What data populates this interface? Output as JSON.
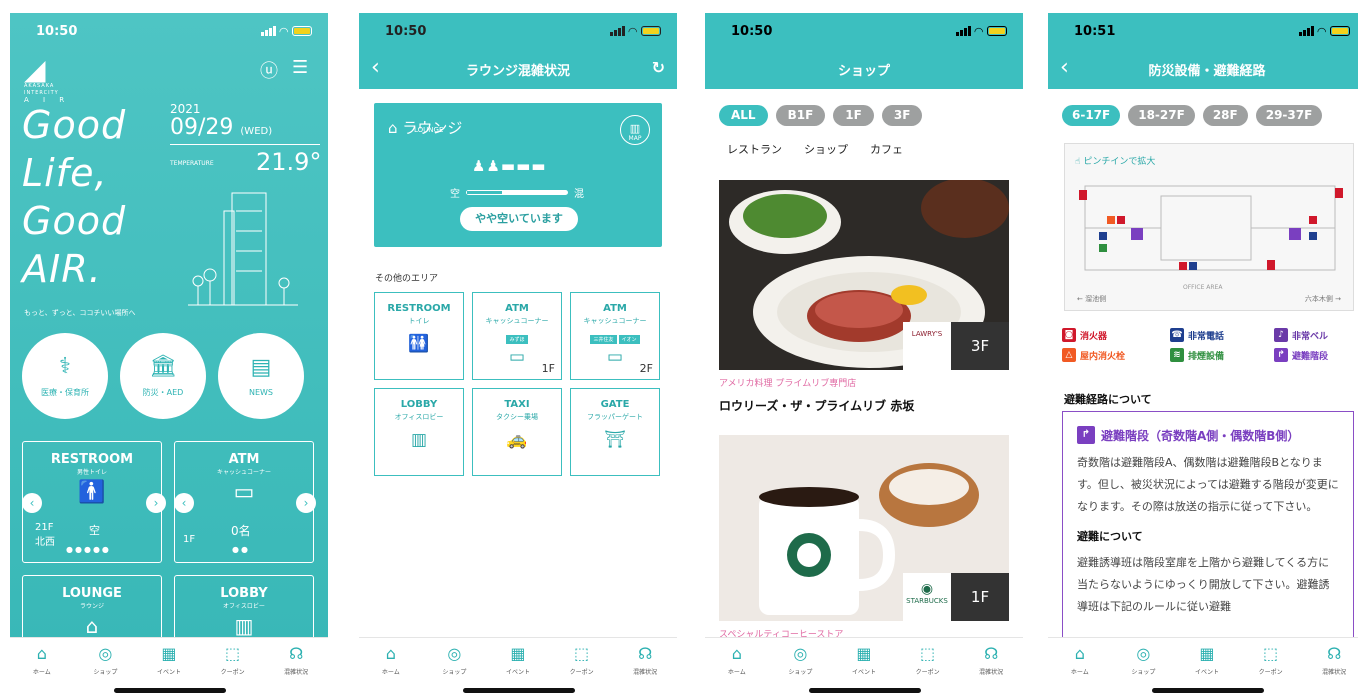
{
  "status_time": [
    "10:50",
    "10:50",
    "10:50",
    "10:51"
  ],
  "tabs": [
    {
      "label": "ホーム",
      "icon": "house-icon"
    },
    {
      "label": "ショップ",
      "icon": "plate-icon"
    },
    {
      "label": "イベント",
      "icon": "calendar-icon"
    },
    {
      "label": "クーポン",
      "icon": "coupon-icon"
    },
    {
      "label": "混雑状況",
      "icon": "crowd-icon"
    }
  ],
  "home": {
    "logo": [
      "AKASAKA",
      "INTERCITY",
      "A I R"
    ],
    "slogan": [
      "Good",
      "Life,",
      "Good",
      "AIR."
    ],
    "tagline": "もっと、ずっと、ココチいい場所へ",
    "year": "2021",
    "date": "09/29",
    "weekday": "(WED)",
    "temp_label": "TEMPERATURE",
    "temp_value": "21.9°",
    "circles": [
      {
        "label": "医療・保育所",
        "icon": "stethoscope-icon"
      },
      {
        "label": "防災・AED",
        "icon": "building-icon"
      },
      {
        "label": "NEWS",
        "icon": "news-icon"
      }
    ],
    "cards": [
      {
        "title": "RESTROOM",
        "sub": "男性トイレ",
        "floor": "21F",
        "area": "北西",
        "state": "空"
      },
      {
        "title": "ATM",
        "sub": "キャッシュコーナー",
        "floor": "1F",
        "count": "0名"
      },
      {
        "title": "LOUNGE",
        "sub": "ラウンジ"
      },
      {
        "title": "LOBBY",
        "sub": "オフィスロビー"
      }
    ]
  },
  "lounge": {
    "title": "ラウンジ混雑状況",
    "tag_small": "LOUNGE",
    "tag": "ラウンジ",
    "map": "MAP",
    "empty": "空",
    "crowded": "混",
    "level": 0.35,
    "status": "やや空いています",
    "other": "その他のエリア",
    "areas": [
      {
        "title": "RESTROOM",
        "sub": "トイレ",
        "icon": "restroom-icon",
        "glyph": "🚻"
      },
      {
        "title": "ATM",
        "sub": "キャッシュコーナー",
        "pills": [
          "みずほ"
        ],
        "floor": "1F",
        "icon": "atm-icon",
        "glyph": "▭"
      },
      {
        "title": "ATM",
        "sub": "キャッシュコーナー",
        "pills": [
          "三井住友",
          "イオン"
        ],
        "floor": "2F",
        "icon": "atm-icon",
        "glyph": "▭"
      },
      {
        "title": "LOBBY",
        "sub": "オフィスロビー",
        "icon": "lobby-icon",
        "glyph": "▥"
      },
      {
        "title": "TAXI",
        "sub": "タクシー乗場",
        "icon": "taxi-icon",
        "glyph": "🚕"
      },
      {
        "title": "GATE",
        "sub": "フラッパーゲート",
        "icon": "gate-icon",
        "glyph": "⛩"
      }
    ]
  },
  "shop": {
    "title": "ショップ",
    "chips": [
      "ALL",
      "B1F",
      "1F",
      "3F"
    ],
    "categories": [
      "レストラン",
      "ショップ",
      "カフェ"
    ],
    "items": [
      {
        "floor": "3F",
        "brand": "LAWRY'S",
        "sub": "アメリカ料理 プライムリブ専門店",
        "name": "ロウリーズ・ザ・プライムリブ 赤坂"
      },
      {
        "floor": "1F",
        "brand": "STARBUCKS",
        "sub": "スペシャルティコーヒーストア",
        "name": ""
      }
    ]
  },
  "safety": {
    "title": "防災設備・避難経路",
    "chips": [
      "6-17F",
      "18-27F",
      "28F",
      "29-37F"
    ],
    "pinch": "ピンチインで拡大",
    "office_area": "OFFICE AREA",
    "left_dir": "← 溜池側",
    "right_dir": "六本木側 →",
    "legend": [
      {
        "label": "消火器",
        "color": "#d0182b",
        "glyph": "◙"
      },
      {
        "label": "非常電話",
        "color": "#1f3f8f",
        "glyph": "☎"
      },
      {
        "label": "非常ベル",
        "color": "#6a3aa8",
        "glyph": "🔔"
      },
      {
        "label": "屋内消火栓",
        "color": "#f15a24",
        "glyph": "△"
      },
      {
        "label": "排煙設備",
        "color": "#2f8f3f",
        "glyph": "≋"
      },
      {
        "label": "避難階段",
        "color": "#7a3fc0",
        "glyph": "↱"
      }
    ],
    "route_head": "避難経路について",
    "box_title": "避難階段（奇数階A側・偶数階B側）",
    "box_text": "奇数階は避難階段A、偶数階は避難階段Bとなります。但し、被災状況によっては避難する階段が変更になります。その際は放送の指示に従って下さい。",
    "box_head2": "避難について",
    "box_text2": "避難誘導班は階段室扉を上階から避難してくる方に当たらないようにゆっくり開放して下さい。避難誘導班は下記のルールに従い避難"
  }
}
